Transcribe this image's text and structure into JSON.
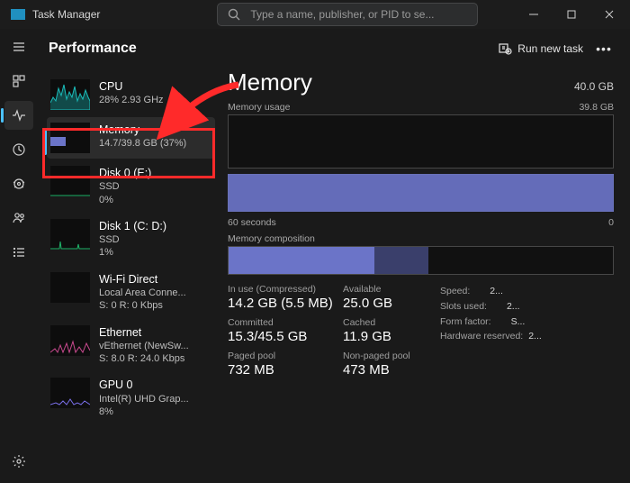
{
  "titlebar": {
    "app_title": "Task Manager",
    "search_placeholder": "Type a name, publisher, or PID to se..."
  },
  "header": {
    "title": "Performance",
    "run_task_label": "Run new task"
  },
  "sidebar": {
    "items": [
      {
        "name": "CPU",
        "line2": "28%  2.93 GHz",
        "selected": false,
        "kind": "cpu"
      },
      {
        "name": "Memory",
        "line2": "14.7/39.8 GB (37%)",
        "selected": true,
        "kind": "mem"
      },
      {
        "name": "Disk 0 (E:)",
        "line2": "SSD",
        "line3": "0%",
        "selected": false,
        "kind": "disk"
      },
      {
        "name": "Disk 1 (C: D:)",
        "line2": "SSD",
        "line3": "1%",
        "selected": false,
        "kind": "disk"
      },
      {
        "name": "Wi-Fi Direct",
        "line2": "Local Area Conne...",
        "line3": "S: 0 R: 0 Kbps",
        "selected": false,
        "kind": "net"
      },
      {
        "name": "Ethernet",
        "line2": "vEthernet (NewSw...",
        "line3": "S: 8.0 R: 24.0 Kbps",
        "selected": false,
        "kind": "eth"
      },
      {
        "name": "GPU 0",
        "line2": "Intel(R) UHD Grap...",
        "line3": "8%",
        "selected": false,
        "kind": "gpu"
      }
    ]
  },
  "main": {
    "title": "Memory",
    "capacity": "40.0 GB",
    "usage_label": "Memory usage",
    "usage_right": "39.8 GB",
    "timeline_left": "60 seconds",
    "timeline_right": "0",
    "composition_label": "Memory composition",
    "stats": {
      "in_use_label": "In use (Compressed)",
      "in_use": "14.2 GB (5.5 MB)",
      "available_label": "Available",
      "available": "25.0 GB",
      "committed_label": "Committed",
      "committed": "15.3/45.5 GB",
      "cached_label": "Cached",
      "cached": "11.9 GB",
      "paged_label": "Paged pool",
      "paged": "732 MB",
      "nonpaged_label": "Non-paged pool",
      "nonpaged": "473 MB"
    },
    "meta": {
      "speed_label": "Speed:",
      "speed": "2...",
      "slots_label": "Slots used:",
      "slots": "2...",
      "form_label": "Form factor:",
      "form": "S...",
      "hw_label": "Hardware reserved:",
      "hw": "2..."
    }
  }
}
